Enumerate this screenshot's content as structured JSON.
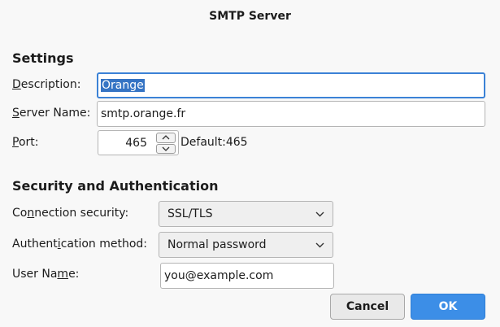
{
  "dialog": {
    "title": "SMTP Server"
  },
  "settings": {
    "heading": "Settings",
    "description_label_accel": "D",
    "description_label_rest": "escription:",
    "description_value": "Orange",
    "server_name_label_accel": "S",
    "server_name_label_rest": "erver Name:",
    "server_name_value": "smtp.orange.fr",
    "port_label_accel": "P",
    "port_label_rest": "ort:",
    "port_value": "465",
    "port_default": "Default:465"
  },
  "security": {
    "heading": "Security and Authentication",
    "connection_label_pre": "Co",
    "connection_label_accel": "n",
    "connection_label_post": "nection security:",
    "connection_value": "SSL/TLS",
    "auth_label_pre": "Authent",
    "auth_label_accel": "i",
    "auth_label_post": "cation method:",
    "auth_value": "Normal password",
    "username_label_pre": "User Na",
    "username_label_accel": "m",
    "username_label_post": "e:",
    "username_value": "you@example.com"
  },
  "buttons": {
    "cancel": "Cancel",
    "ok": "OK"
  },
  "icons": {
    "spin_up": "chevron-up-icon",
    "spin_down": "chevron-down-icon",
    "dropdown": "chevron-down-icon"
  },
  "colors": {
    "accent": "#3c8ee7",
    "focus_border": "#3b82d6",
    "selection": "#3574c4"
  }
}
